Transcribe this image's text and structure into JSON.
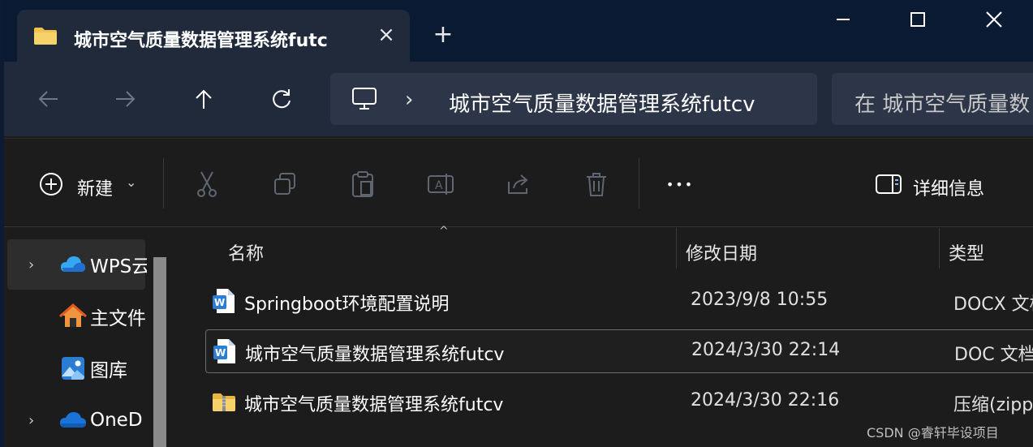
{
  "titlebar": {
    "tab_title": "城市空气质量数据管理系统futc",
    "close_tab": "×",
    "new_tab": "+"
  },
  "address": {
    "path": "城市空气质量数据管理系统futcv",
    "separator": "›",
    "search_placeholder": "在 城市空气质量数"
  },
  "commandbar": {
    "new_label": "新建",
    "new_caret": "⌄",
    "more_label": "•••",
    "details_label": "详细信息"
  },
  "navpane": {
    "items": [
      {
        "label": "WPS云",
        "chevron": "›",
        "icon": "wps-cloud-icon"
      },
      {
        "label": "主文件",
        "chevron": "",
        "icon": "home-icon"
      },
      {
        "label": "图库",
        "chevron": "",
        "icon": "gallery-icon"
      },
      {
        "label": "OneD",
        "chevron": "›",
        "icon": "onedrive-icon"
      }
    ]
  },
  "filelist": {
    "columns": {
      "name": "名称",
      "modified": "修改日期",
      "type": "类型"
    },
    "sort_indicator": "^",
    "rows": [
      {
        "name": "Springboot环境配置说明",
        "modified": "2023/9/8 10:55",
        "type": "DOCX 文档",
        "icon": "word-doc-icon"
      },
      {
        "name": "城市空气质量数据管理系统futcv",
        "modified": "2024/3/30 22:14",
        "type": "DOC 文档",
        "icon": "word-doc-icon"
      },
      {
        "name": "城市空气质量数据管理系统futcv",
        "modified": "2024/3/30 22:16",
        "type": "压缩(zipped)",
        "icon": "zip-folder-icon"
      }
    ]
  },
  "watermark": "CSDN @睿轩毕设项目",
  "colors": {
    "window_bg": "#1c1c1c",
    "titlebar_bg": "#0b1a33",
    "accent_blue": "#2b7cd3",
    "folder_yellow": "#f2c14e"
  }
}
